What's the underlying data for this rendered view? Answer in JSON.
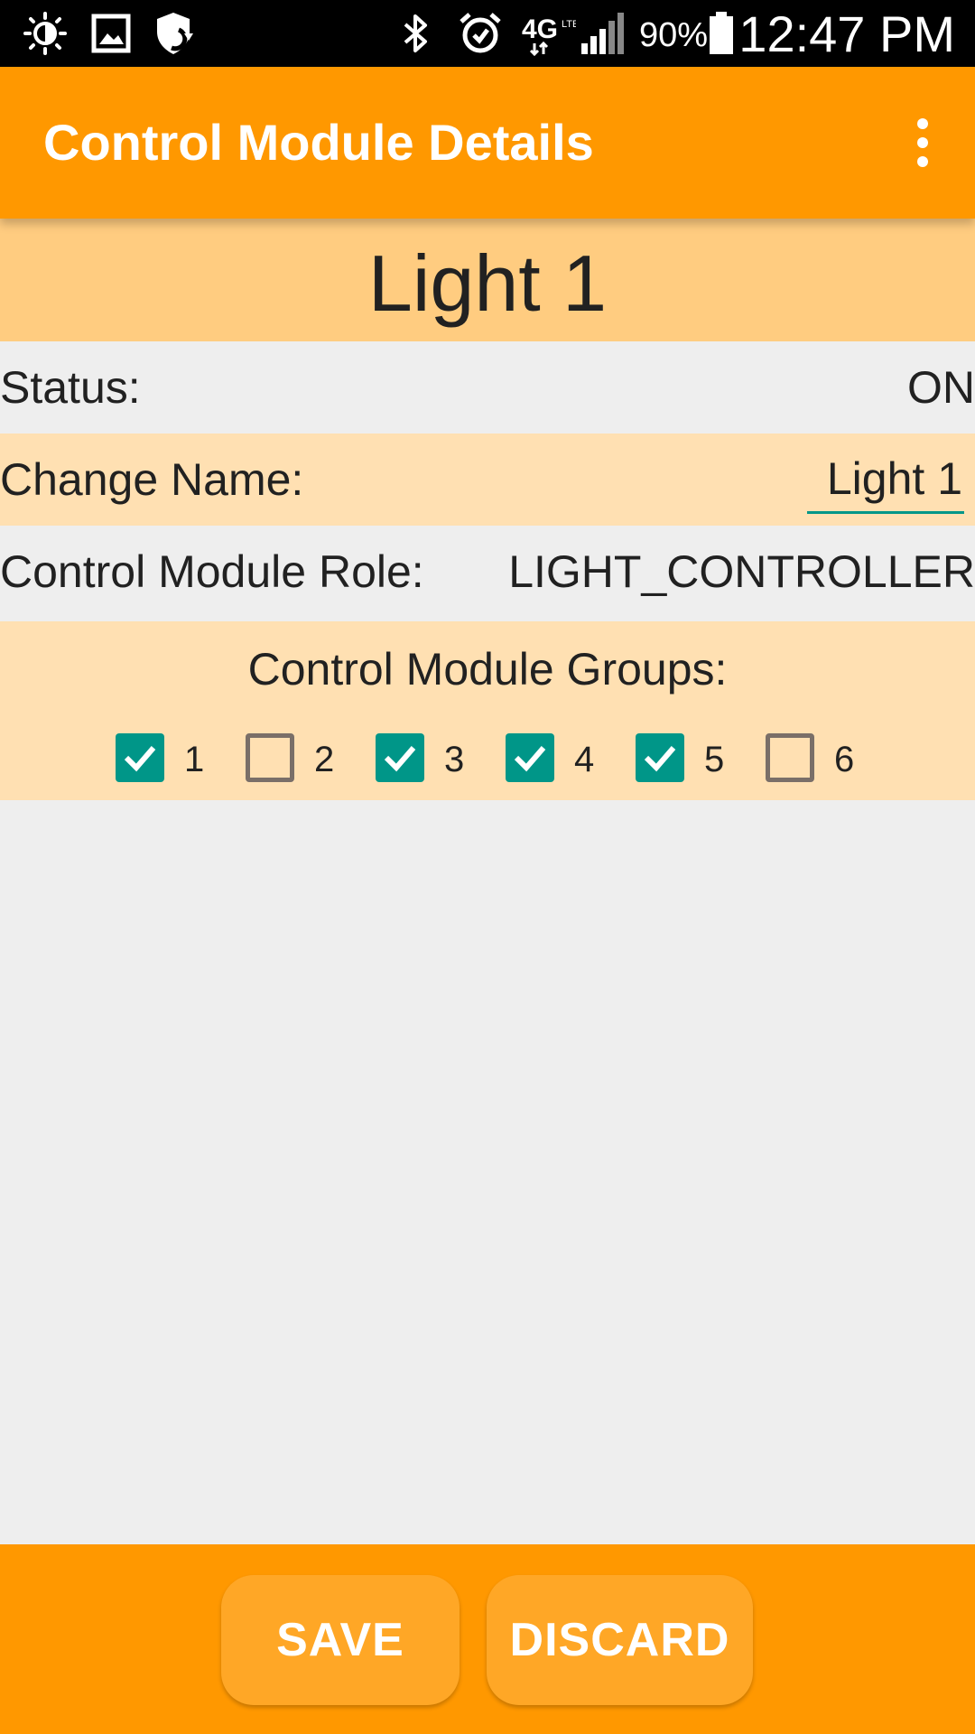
{
  "status_bar": {
    "battery_percent": "90%",
    "time": "12:47 PM",
    "network": "4G"
  },
  "app_bar": {
    "title": "Control Module Details"
  },
  "device": {
    "name": "Light 1"
  },
  "status_row": {
    "label": "Status:",
    "value": "ON"
  },
  "name_row": {
    "label": "Change Name:",
    "value": "Light 1"
  },
  "role_row": {
    "label": "Control Module Role:",
    "value": "LIGHT_CONTROLLER"
  },
  "groups": {
    "title": "Control Module Groups:",
    "items": [
      {
        "label": "1",
        "checked": true
      },
      {
        "label": "2",
        "checked": false
      },
      {
        "label": "3",
        "checked": true
      },
      {
        "label": "4",
        "checked": true
      },
      {
        "label": "5",
        "checked": true
      },
      {
        "label": "6",
        "checked": false
      }
    ]
  },
  "actions": {
    "save_label": "SAVE",
    "discard_label": "DISCARD"
  },
  "colors": {
    "primary": "#ff9800",
    "header_band": "#ffcc80",
    "row_band": "#ffe0b2",
    "checkbox_accent": "#009688",
    "button": "#ffa726"
  }
}
